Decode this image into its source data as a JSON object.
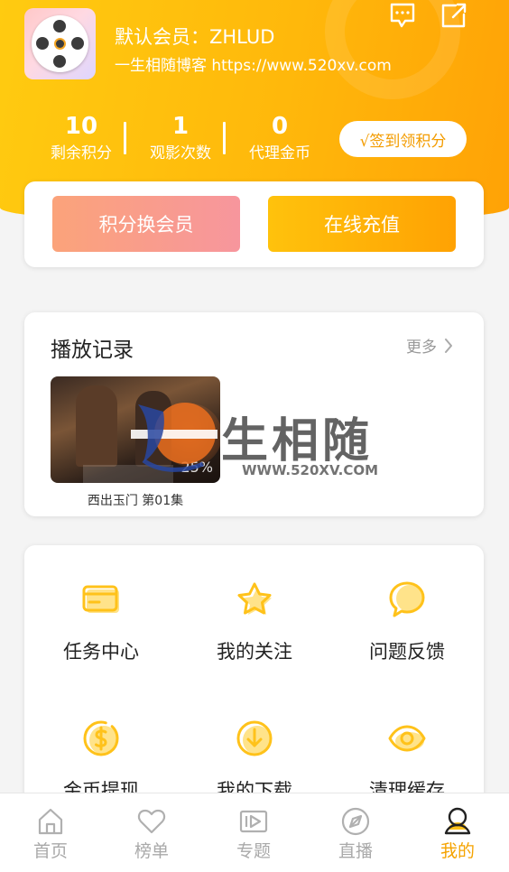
{
  "header": {
    "member_label": "默认会员：ZHLUD",
    "slogan": "一生相随博客 https://www.520xv.com",
    "message_icon": "message-dots-icon",
    "share_icon": "share-icon"
  },
  "stats": [
    {
      "value": "10",
      "label": "剩余积分"
    },
    {
      "value": "1",
      "label": "观影次数"
    },
    {
      "value": "0",
      "label": "代理金币"
    }
  ],
  "checkin_label": "√签到领积分",
  "actions": {
    "exchange_label": "积分换会员",
    "recharge_label": "在线充值"
  },
  "history": {
    "title": "播放记录",
    "more_label": "更多",
    "items": [
      {
        "title": "西出玉门 第01集",
        "progress": "25%"
      }
    ]
  },
  "watermark": {
    "text": "生相随",
    "url": "WWW.520XV.COM"
  },
  "menu": [
    {
      "label": "任务中心",
      "icon": "task-card-icon"
    },
    {
      "label": "我的关注",
      "icon": "star-icon"
    },
    {
      "label": "问题反馈",
      "icon": "feedback-chat-icon"
    },
    {
      "label": "金币提现",
      "icon": "dollar-coin-icon"
    },
    {
      "label": "我的下载",
      "icon": "download-icon"
    },
    {
      "label": "清理缓存",
      "icon": "eye-icon"
    }
  ],
  "tabs": [
    {
      "label": "首页",
      "icon": "home-icon"
    },
    {
      "label": "榜单",
      "icon": "heart-icon"
    },
    {
      "label": "专题",
      "icon": "video-play-icon"
    },
    {
      "label": "直播",
      "icon": "compass-icon"
    },
    {
      "label": "我的",
      "icon": "user-icon",
      "active": true
    }
  ],
  "colors": {
    "accent": "#ffb80b",
    "active_tab": "#f5a300",
    "icon_yellow": "#ffc21a"
  }
}
